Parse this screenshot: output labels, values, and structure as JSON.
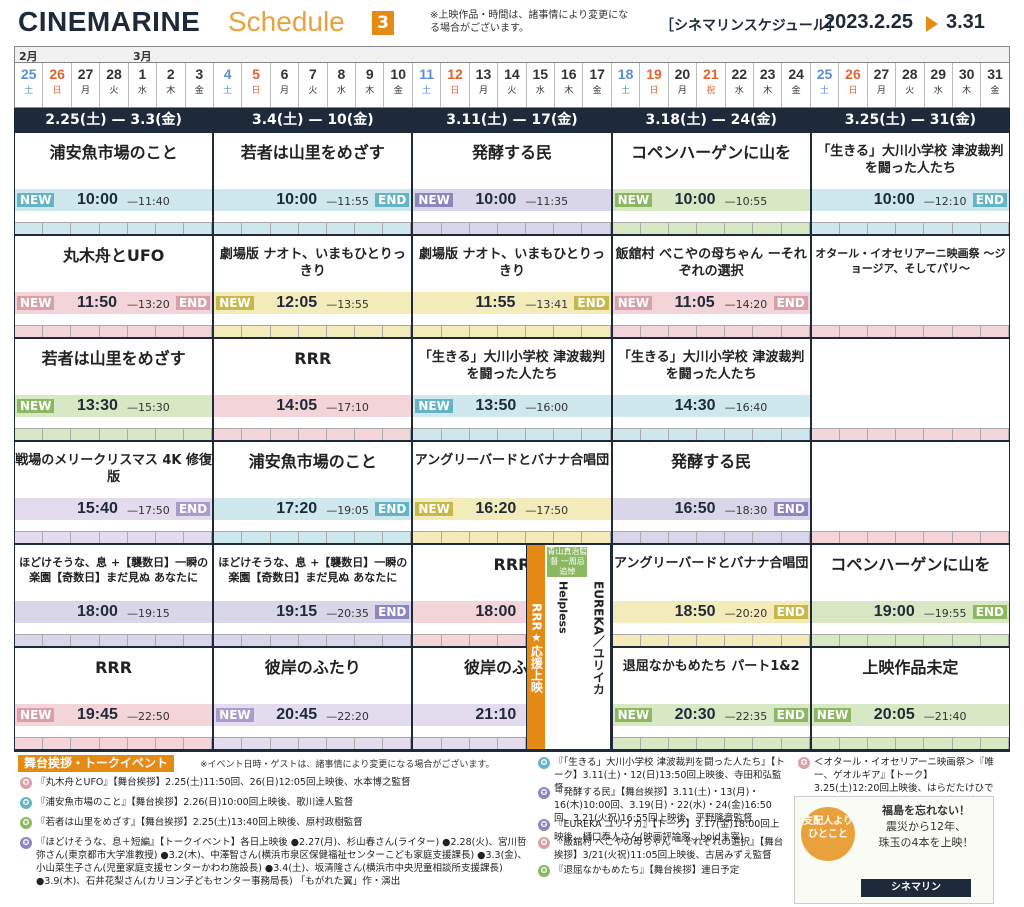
{
  "header": {
    "brand": "CINEMARINE",
    "brand_sub": "Schedule",
    "issue": "3",
    "note": "※上映作品・時間は、諸事情により変更になる場合がございます。",
    "jp_title": "［シネマリンスケジュール］",
    "date_start": "2023.2.25",
    "date_end": "3.31"
  },
  "calendar": {
    "months": [
      "2月",
      "3月"
    ],
    "days": [
      {
        "n": "25",
        "w": "土",
        "c": "#5a8fd6"
      },
      {
        "n": "26",
        "w": "日",
        "c": "#e2612f"
      },
      {
        "n": "27",
        "w": "月",
        "c": "#333"
      },
      {
        "n": "28",
        "w": "火",
        "c": "#333"
      },
      {
        "n": "1",
        "w": "水",
        "c": "#333"
      },
      {
        "n": "2",
        "w": "木",
        "c": "#333"
      },
      {
        "n": "3",
        "w": "金",
        "c": "#333"
      },
      {
        "n": "4",
        "w": "土",
        "c": "#5a8fd6"
      },
      {
        "n": "5",
        "w": "日",
        "c": "#e2612f"
      },
      {
        "n": "6",
        "w": "月",
        "c": "#333"
      },
      {
        "n": "7",
        "w": "火",
        "c": "#333"
      },
      {
        "n": "8",
        "w": "水",
        "c": "#333"
      },
      {
        "n": "9",
        "w": "木",
        "c": "#333"
      },
      {
        "n": "10",
        "w": "金",
        "c": "#333"
      },
      {
        "n": "11",
        "w": "土",
        "c": "#5a8fd6"
      },
      {
        "n": "12",
        "w": "日",
        "c": "#e2612f"
      },
      {
        "n": "13",
        "w": "月",
        "c": "#333"
      },
      {
        "n": "14",
        "w": "火",
        "c": "#333"
      },
      {
        "n": "15",
        "w": "水",
        "c": "#333"
      },
      {
        "n": "16",
        "w": "木",
        "c": "#333"
      },
      {
        "n": "17",
        "w": "金",
        "c": "#333"
      },
      {
        "n": "18",
        "w": "土",
        "c": "#5a8fd6"
      },
      {
        "n": "19",
        "w": "日",
        "c": "#e2612f"
      },
      {
        "n": "20",
        "w": "月",
        "c": "#333"
      },
      {
        "n": "21",
        "w": "祝",
        "c": "#e2612f"
      },
      {
        "n": "22",
        "w": "水",
        "c": "#333"
      },
      {
        "n": "23",
        "w": "木",
        "c": "#333"
      },
      {
        "n": "24",
        "w": "金",
        "c": "#333"
      },
      {
        "n": "25",
        "w": "土",
        "c": "#5a8fd6"
      },
      {
        "n": "26",
        "w": "日",
        "c": "#e2612f"
      },
      {
        "n": "27",
        "w": "月",
        "c": "#333"
      },
      {
        "n": "28",
        "w": "火",
        "c": "#333"
      },
      {
        "n": "29",
        "w": "水",
        "c": "#333"
      },
      {
        "n": "30",
        "w": "木",
        "c": "#333"
      },
      {
        "n": "31",
        "w": "金",
        "c": "#333"
      }
    ]
  },
  "weeks": [
    {
      "label": "2.25(土) — 3.3(金)"
    },
    {
      "label": "3.4(土) — 10(金)"
    },
    {
      "label": "3.11(土) — 17(金)"
    },
    {
      "label": "3.18(土) — 24(金)"
    },
    {
      "label": "3.25(土) — 31(金)"
    }
  ],
  "grid": {
    "w1": [
      {
        "t": "浦安魚市場のこと",
        "time": "10:00",
        "end": "—11:40",
        "new": "NEW",
        "endtag": "",
        "col": "c-blue"
      },
      {
        "t": "丸木舟とUFO",
        "time": "11:50",
        "end": "—13:20",
        "new": "NEW",
        "endtag": "END",
        "col": "c-pink"
      },
      {
        "t": "若者は山里をめざす",
        "time": "13:30",
        "end": "—15:30",
        "new": "NEW",
        "endtag": "",
        "col": "c-green"
      },
      {
        "t": "戦場のメリークリスマス 4K 修復版",
        "time": "15:40",
        "end": "—17:50",
        "new": "",
        "endtag": "END",
        "col": "c-lav"
      },
      {
        "t": "ほどけそうな、息 +【襲数日】一瞬の楽園【奇数日】まだ見ぬ あなたに",
        "time": "18:00",
        "end": "—19:15",
        "new": "",
        "endtag": "",
        "col": "c-purple"
      },
      {
        "t": "RRR",
        "time": "19:45",
        "end": "—22:50",
        "new": "NEW",
        "endtag": "",
        "col": "c-pink"
      }
    ],
    "w2": [
      {
        "t": "若者は山里をめざす",
        "time": "10:00",
        "end": "—11:55",
        "new": "",
        "endtag": "END",
        "col": "c-blue"
      },
      {
        "t": "劇場版 ナオト、いまもひとりっきり",
        "time": "12:05",
        "end": "—13:55",
        "new": "NEW",
        "endtag": "",
        "col": "c-yellow"
      },
      {
        "t": "RRR",
        "time": "14:05",
        "end": "—17:10",
        "new": "",
        "endtag": "",
        "col": "c-pink"
      },
      {
        "t": "浦安魚市場のこと",
        "time": "17:20",
        "end": "—19:05",
        "new": "",
        "endtag": "END",
        "col": "c-blue"
      },
      {
        "t": "ほどけそうな、息 +【襲数日】一瞬の楽園【奇数日】まだ見ぬ あなたに",
        "time": "19:15",
        "end": "—20:35",
        "new": "",
        "endtag": "END",
        "col": "c-purple"
      },
      {
        "t": "彼岸のふたり",
        "time": "20:45",
        "end": "—22:20",
        "new": "NEW",
        "endtag": "",
        "col": "c-lav"
      }
    ],
    "w3": [
      {
        "t": "発酵する民",
        "time": "10:00",
        "end": "—11:35",
        "new": "NEW",
        "endtag": "",
        "col": "c-purple"
      },
      {
        "t": "劇場版 ナオト、いまもひとりっきり",
        "time": "11:55",
        "end": "—13:41",
        "new": "",
        "endtag": "END",
        "col": "c-yellow"
      },
      {
        "t": "「生きる」大川小学校 津波裁判を闘った人たち",
        "time": "13:50",
        "end": "—16:00",
        "new": "NEW",
        "endtag": "",
        "col": "c-blue"
      },
      {
        "t": "アングリーバードとバナナ合唱団",
        "time": "16:20",
        "end": "—17:50",
        "new": "NEW",
        "endtag": "",
        "col": "c-yellow"
      },
      {
        "t": "RRR",
        "time": "18:00",
        "end": "—21:00",
        "new": "",
        "endtag": "",
        "col": "c-pink"
      },
      {
        "t": "彼岸のふたり",
        "time": "21:10",
        "end": "—22:45",
        "new": "",
        "endtag": "END",
        "col": "c-lav"
      }
    ],
    "w4": [
      {
        "t": "コペンハーゲンに山を",
        "time": "10:00",
        "end": "—10:55",
        "new": "NEW",
        "endtag": "",
        "col": "c-green"
      },
      {
        "t": "飯舘村 べこやの母ちゃん ーそれぞれの選択",
        "time": "11:05",
        "end": "—14:20",
        "new": "NEW",
        "endtag": "END",
        "col": "c-pink"
      },
      {
        "t": "「生きる」大川小学校 津波裁判を闘った人たち",
        "time": "14:30",
        "end": "—16:40",
        "new": "",
        "endtag": "",
        "col": "c-blue"
      },
      {
        "t": "発酵する民",
        "time": "16:50",
        "end": "—18:30",
        "new": "",
        "endtag": "END",
        "col": "c-purple"
      },
      {
        "t": "アングリーバードとバナナ合唱団",
        "time": "18:50",
        "end": "—20:20",
        "new": "",
        "endtag": "END",
        "col": "c-yellow"
      },
      {
        "t": "退屈なかもめたち パート1&2",
        "time": "20:30",
        "end": "—22:35",
        "new": "NEW",
        "endtag": "END",
        "col": "c-green"
      }
    ],
    "w5": [
      {
        "t": "「生きる」大川小学校 津波裁判を闘った人たち",
        "time": "10:00",
        "end": "—12:10",
        "new": "",
        "endtag": "END",
        "col": "c-blue"
      },
      {
        "t": "オタール・イオセリアーニ映画祭 〜ジョージア、そしてパリ〜",
        "time": "",
        "end": "",
        "new": "",
        "endtag": "",
        "col": "c-pink"
      },
      {
        "t": "",
        "time": "",
        "end": "",
        "new": "",
        "endtag": "",
        "col": "c-pink"
      },
      {
        "t": "",
        "time": "",
        "end": "",
        "new": "",
        "endtag": "",
        "col": "c-pink"
      },
      {
        "t": "コペンハーゲンに山を",
        "time": "19:00",
        "end": "—19:55",
        "new": "",
        "endtag": "END",
        "col": "c-green"
      },
      {
        "t": "上映作品未定",
        "time": "20:05",
        "end": "—21:40",
        "new": "NEW",
        "endtag": "",
        "col": "c-green"
      }
    ]
  },
  "special": {
    "rrr_support": "RRR★応援上映",
    "aoyama": "青山真治監督 一周忌追悼",
    "helpless": "Helpless",
    "eureka": "EUREKA／ユリイカ"
  },
  "events": {
    "title": "舞台挨拶・トークイベント",
    "note": "※イベント日時・ゲストは、諸事情により変更になる場合がございます。",
    "left": [
      {
        "text": "『丸木舟とUFO』【舞台挨拶】2.25(土)11:50回、26(日)12:05回上映後、水本博之監督",
        "c": "#d9a0a7"
      },
      {
        "text": "『浦安魚市場のこと』【舞台挨拶】2.26(日)10:00回上映後、歌川達人監督",
        "c": "#64b3c6"
      },
      {
        "text": "『若者は山里をめざす』【舞台挨拶】2.25(土)13:40回上映後、原村政樹監督",
        "c": "#8cb862"
      },
      {
        "text": "『ほどけそうな、息＋短編』【トークイベント】各日上映後 ●2.27(月)、杉山春さん(ライター) ●2.28(火)、宮川哲弥さん(東京都市大学准教授) ●3.2(木)、中澤智さん(横浜市泉区保健福祉センターこども家庭支援課長) ●3.3(金)、小山菜生子さん(児童家庭支援センターかわわ施設長) ●3.4(土)、坂清隆さん(横浜市中央児童相談所支援課長) ●3.9(木)、石井花梨さん(カリヨン子どもセンター事務局長) 「もがれた翼」作・演出",
        "c": "#8c86bf"
      }
    ],
    "mid": [
      {
        "text": "『「生きる」大川小学校 津波裁判を闘った人たち』【トーク】3.11(土)・12(日)13:50回上映後、寺田和弘監督",
        "c": "#64b3c6"
      },
      {
        "text": "『発酵する民』【舞台挨拶】3.11(土)・13(月)・16(木)10:00回、3.19(日)・22(水)・24(金)16:50回、3.21(火祝)16:55回上映後、平野隆章監督",
        "c": "#8c86bf"
      },
      {
        "text": "『EUREKA ユリイカ』【トーク】3.17(金)18:00回上映後、樋口泰人さん(映画評論家、boid主宰)",
        "c": "#8c86bf"
      },
      {
        "text": "『飯舘村 べこやの母ちゃん ーそれぞれの選択』【舞台挨拶】3/21(火祝)11:05回上映後、古居みずえ監督",
        "c": "#d9a0a7"
      },
      {
        "text": "『退屈なかもめたち』【舞台挨拶】連日予定",
        "c": "#8cb862"
      }
    ],
    "right": {
      "text": "＜オタール・イオセリアーニ映画祭＞『唯一、ゲオルギア』【トーク】3.25(土)12:20回上映後、はらだたけひでさん(ジョージア映画祭2022主宰/画家)",
      "c": "#d9a0a7"
    },
    "box": {
      "circle": "支配人よりひとこと",
      "msg1": "福島を忘れない！",
      "msg2": "震災から12年、",
      "msg3": "珠玉の4本を上映！",
      "logo": "シネマリン"
    }
  }
}
